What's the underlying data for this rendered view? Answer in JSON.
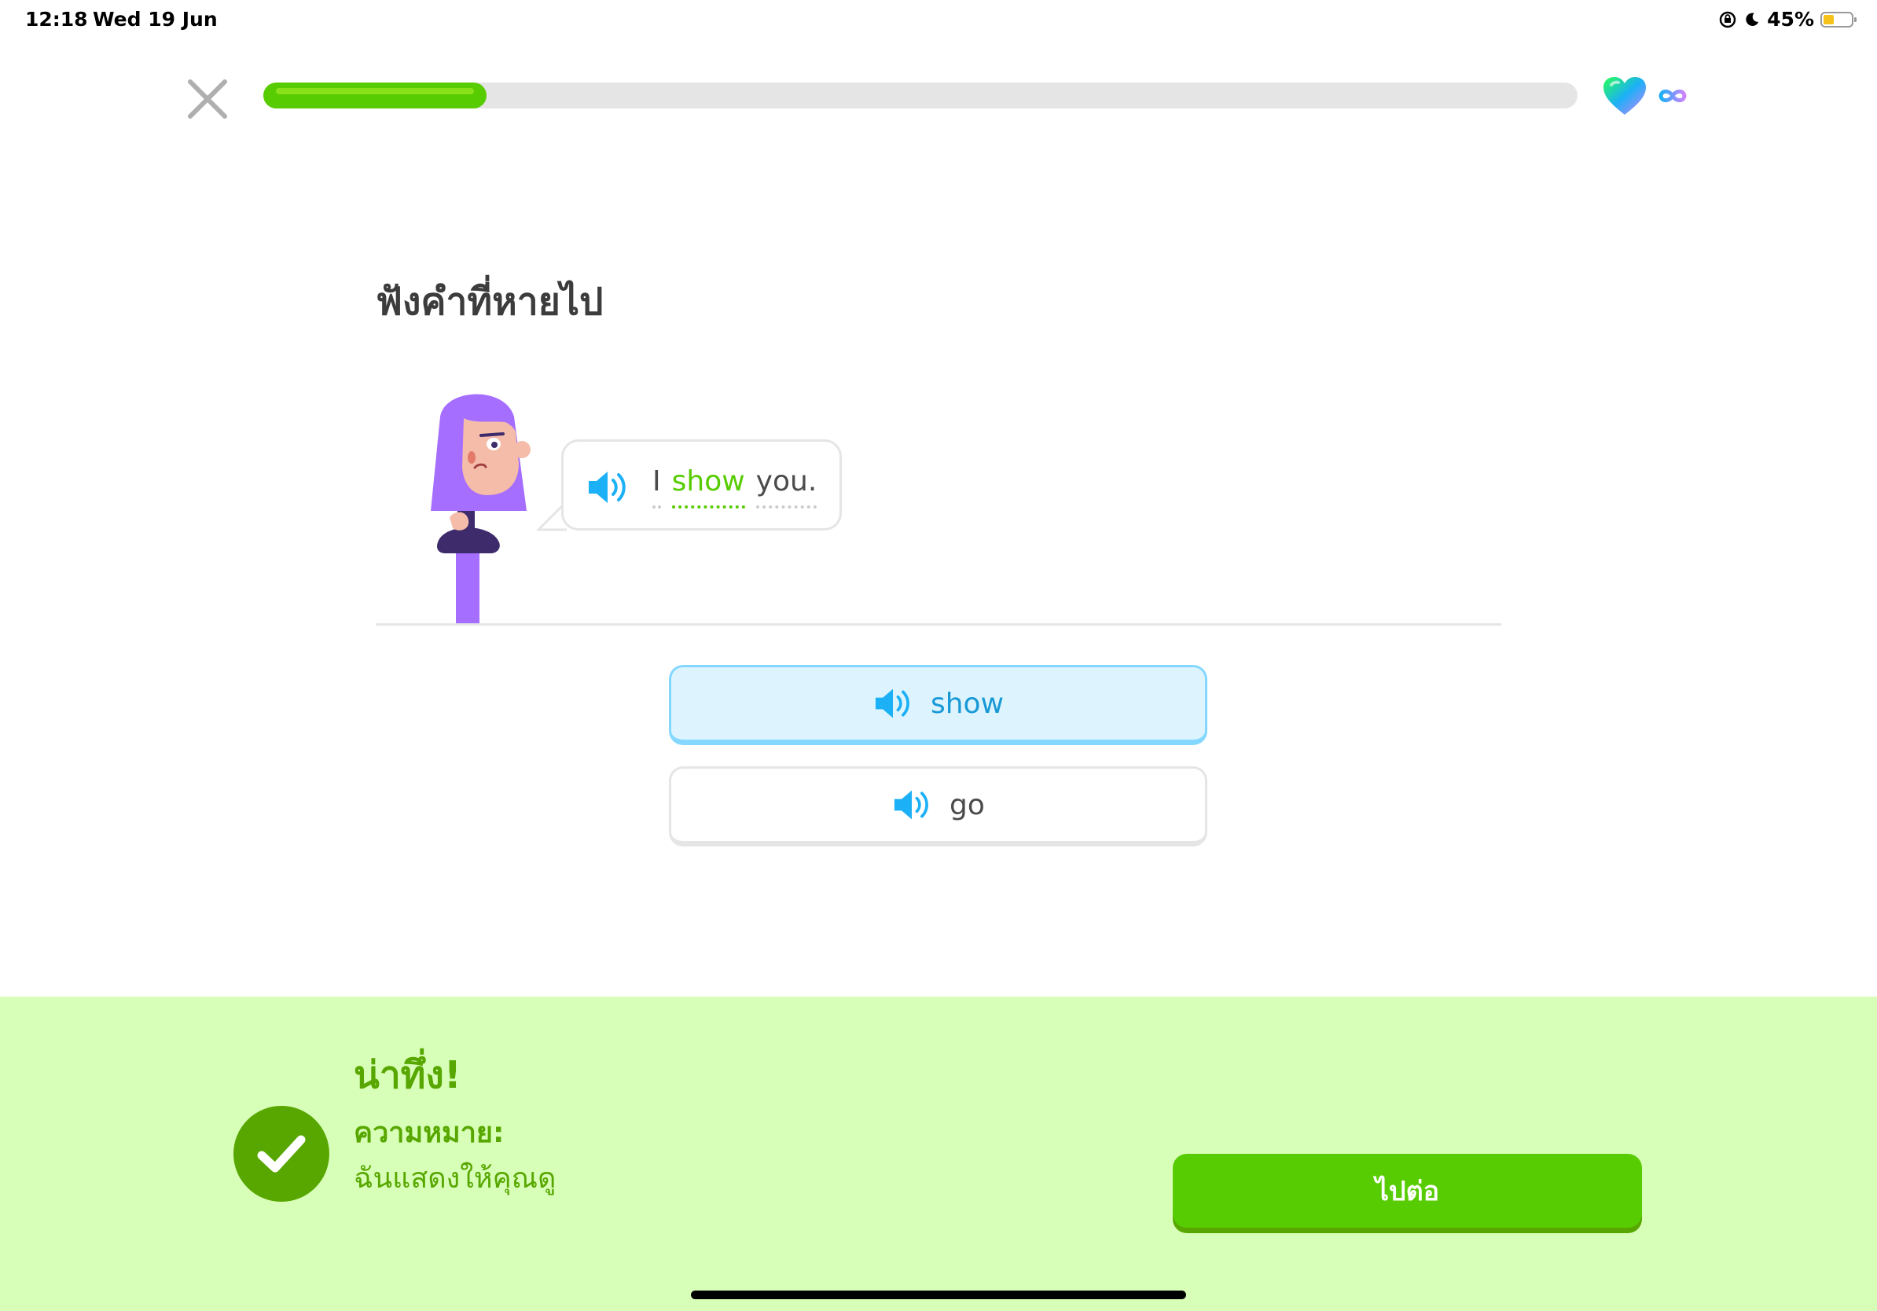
{
  "status_bar": {
    "time": "12:18",
    "date": "Wed 19 Jun",
    "battery_text": "45%",
    "battery_level": 0.45
  },
  "lesson": {
    "progress": 0.17,
    "hearts": "∞"
  },
  "instruction": "ฟังคำที่หายไป",
  "bubble": {
    "words": [
      "I",
      "show",
      "you."
    ]
  },
  "options": [
    {
      "label": "show",
      "selected": true
    },
    {
      "label": "go",
      "selected": false
    }
  ],
  "feedback": {
    "title": "น่าทึ่ง!",
    "meaning_label": "ความหมาย:",
    "meaning_text": "ฉันแสดงให้คุณดู",
    "continue_label": "ไปต่อ"
  },
  "colors": {
    "accent_green": "#58cc02",
    "dark_green": "#58a700",
    "feedback_bg": "#d7ffb8",
    "selected_bg": "#ddf4ff",
    "selected_border": "#84d8ff",
    "speaker_blue": "#1cb0f6",
    "character_purple": "#a56eff"
  },
  "icons": {
    "close": "close-icon",
    "heart": "heart-icon",
    "infinity": "infinity-icon",
    "speaker": "speaker-icon",
    "check": "check-icon",
    "character": "lily-character"
  }
}
